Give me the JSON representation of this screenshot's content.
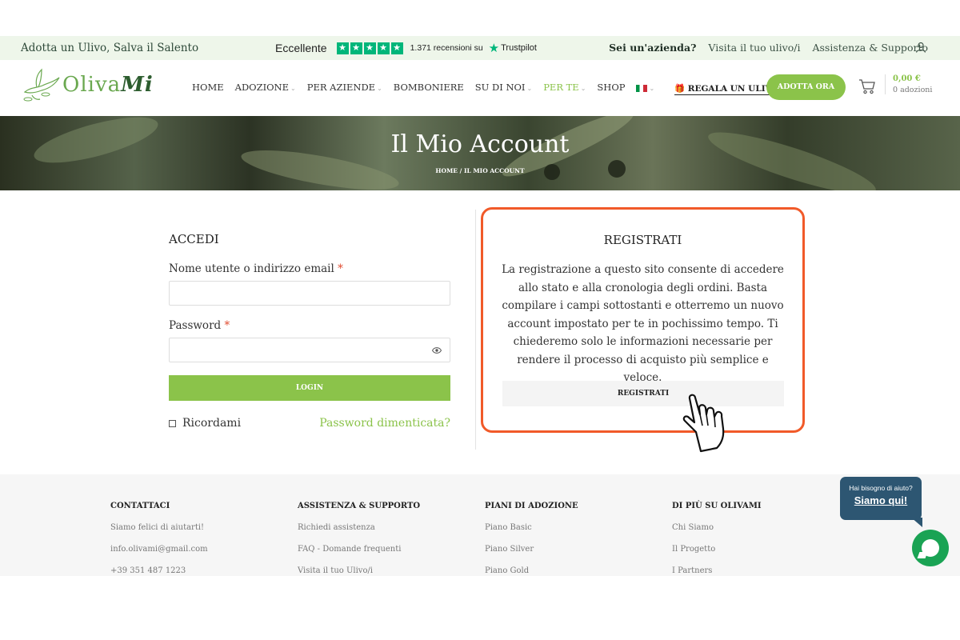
{
  "topbar": {
    "tagline": "Adotta un Ulivo, Salva il Salento",
    "trustpilot": {
      "rating_label": "Eccellente",
      "reviews": "1.371 recensioni su",
      "brand": "Trustpilot",
      "star_color": "#00b67a"
    },
    "links": [
      "Sei un'azienda?",
      "Visita il tuo ulivo/i",
      "Assistenza & Supporto"
    ],
    "user_icon": "user-icon"
  },
  "header": {
    "logo_text": "Oliva",
    "logo_text_italic": "Mi",
    "nav": [
      {
        "label": "HOME",
        "caret": false,
        "active": false
      },
      {
        "label": "ADOZIONE",
        "caret": true,
        "active": false
      },
      {
        "label": "PER AZIENDE",
        "caret": true,
        "active": false
      },
      {
        "label": "BOMBONIERE",
        "caret": false,
        "active": false
      },
      {
        "label": "SU DI NOI",
        "caret": true,
        "active": false
      },
      {
        "label": "PER TE",
        "caret": true,
        "active": true
      },
      {
        "label": "SHOP",
        "caret": false,
        "active": false
      }
    ],
    "regala": "🎁 REGALA UN ULIVO",
    "cta": "ADOTTA ORA",
    "cart_price": "0,00 €",
    "cart_count": "0 adozioni",
    "accent": "#8bc34a"
  },
  "hero": {
    "title": "Il Mio Account",
    "breadcrumb": "HOME  /  IL MIO ACCOUNT"
  },
  "login": {
    "title": "ACCEDI",
    "username_label": "Nome utente o indirizzo email",
    "password_label": "Password",
    "required_mark": "*",
    "username_value": "",
    "password_value": "",
    "button": "LOGIN",
    "remember": "Ricordami",
    "forgot": "Password dimenticata?"
  },
  "register": {
    "title": "REGISTRATI",
    "text": "La registrazione a questo sito consente di accedere allo stato e alla cronologia degli ordini. Basta compilare i campi sottostanti e otterremo un nuovo account impostato per te in pochissimo tempo. Ti chiederemo solo le informazioni necessarie per rendere il processo di acquisto più semplice e veloce.",
    "button": "REGISTRATI",
    "highlight_color": "#f15a29"
  },
  "footer": {
    "columns": [
      {
        "title": "CONTATTACI",
        "items": [
          "Siamo felici di aiutarti!",
          "info.olivami@gmail.com",
          "+39 351 487 1223"
        ]
      },
      {
        "title": "ASSISTENZA & SUPPORTO",
        "items": [
          "Richiedi assistenza",
          "FAQ - Domande frequenti",
          "Visita il tuo Ulivo/i"
        ]
      },
      {
        "title": "PIANI DI ADOZIONE",
        "items": [
          "Piano Basic",
          "Piano Silver",
          "Piano Gold"
        ]
      },
      {
        "title": "DI PIÙ SU OLIVAMI",
        "items": [
          "Chi Siamo",
          "Il Progetto",
          "I Partners"
        ]
      }
    ]
  },
  "chat": {
    "question": "Hai bisogno di aiuto?",
    "link": "Siamo qui!",
    "color": "#1aa354"
  }
}
